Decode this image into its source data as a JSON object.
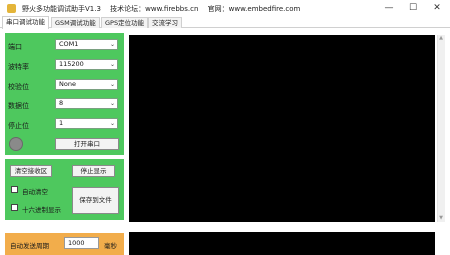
{
  "window": {
    "title": "野火多功能调试助手V1.3",
    "forum_label": "技术论坛：www.firebbs.cn",
    "site_label": "官网：www.embedfire.com",
    "controls": {
      "minimize": "—",
      "maximize": "☐",
      "close": "✕"
    }
  },
  "tabs": [
    {
      "label": "串口调试功能",
      "active": true
    },
    {
      "label": "GSM调试功能",
      "active": false
    },
    {
      "label": "GPS定位功能",
      "active": false
    },
    {
      "label": "交流学习",
      "active": false
    }
  ],
  "serial": {
    "port": {
      "label": "端口",
      "value": "COM1"
    },
    "baud": {
      "label": "波特率",
      "value": "115200"
    },
    "parity": {
      "label": "校验位",
      "value": "None"
    },
    "databits": {
      "label": "数据位",
      "value": "8"
    },
    "stopbits": {
      "label": "停止位",
      "value": "1"
    },
    "open_button": "打开串口"
  },
  "receive": {
    "clear_button": "清空接收区",
    "pause_button": "停止显示",
    "auto_clear_label": "自动清空",
    "hex_display_label": "十六进制显示",
    "save_button": "保存到文件"
  },
  "send": {
    "auto_send_label": "自动发送周期",
    "period_value": "1000",
    "unit": "毫秒"
  },
  "colors": {
    "panel_green": "#4ec85e",
    "send_orange": "#f2ad4b",
    "display_black": "#000000"
  }
}
